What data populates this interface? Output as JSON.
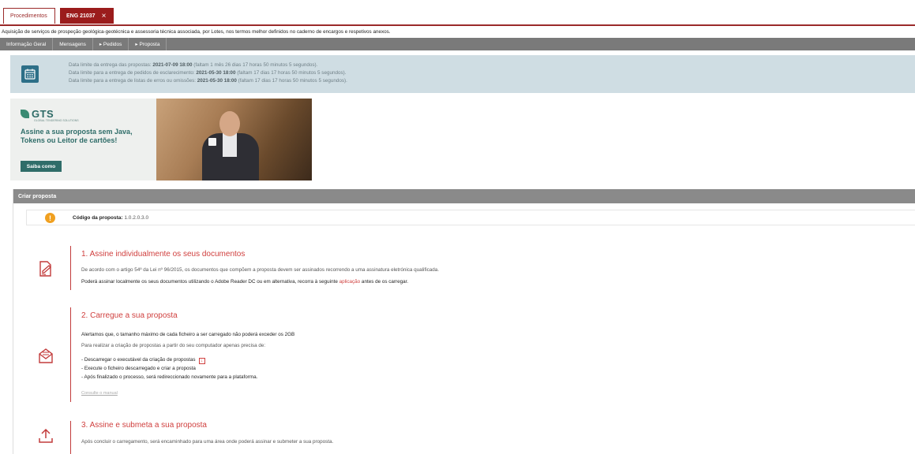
{
  "tabs": {
    "procedimentos": "Procedimentos",
    "current": "ENG 21037",
    "close": "×"
  },
  "subject": "Aquisição de serviços de prospeção geológica-geotécnica e assessoria técnica associada, por Lotes, nos termos melhor definidos no caderno de encargos e respetivos anexos.",
  "nav": {
    "items": [
      "Informação Geral",
      "Mensagens",
      "▸ Pedidos",
      "▸ Proposta"
    ]
  },
  "deadlines": {
    "icon": "calendar-icon",
    "line1_prefix": "Data limite da entrega das propostas: ",
    "line1_date": "2021-07-09 18:00",
    "line1_suffix": " (faltam 1 mês 26 dias 17 horas 50 minutos 5 segundos).",
    "line2_prefix": "Data limite para a entrega de pedidos de esclarecimento: ",
    "line2_date": "2021-05-30 18:00",
    "line2_suffix": " (faltam 17 dias 17 horas 50 minutos 5 segundos).",
    "line3_prefix": "Data limite para a entrega de listas de erros ou omissões: ",
    "line3_date": "2021-05-30 18:00",
    "line3_suffix": " (faltam 17 dias 17 horas 50 minutos 5 segundos)."
  },
  "banner": {
    "logo": "GTS",
    "logo_sub": "GLOBAL TENDERING SOLUTIONS",
    "headline": "Assine a sua proposta sem Java, Tokens ou Leitor de cartões!",
    "button": "Saiba como"
  },
  "panel": {
    "title": "Criar proposta",
    "code_label": "Código da proposta:",
    "code_value": " 1.0.2.0.3.0"
  },
  "steps": {
    "s1": {
      "icon": "sign-document-icon",
      "title": "1. Assine individualmente os seus documentos",
      "line1": "De acordo com o artigo 54º da Lei nº 96/2015, os documentos que compõem a proposta devem ser assinados recorrendo a uma assinatura eletrónica qualificada.",
      "line2_prefix": "Poderá assinar localmente os seus documentos utilizando o Adobe Reader DC ou em alternativa, recorra à seguinte ",
      "line2_link": "aplicação",
      "line2_suffix": " antes de os carregar."
    },
    "s2": {
      "icon": "upload-envelope-icon",
      "title": "2. Carregue a sua proposta",
      "line1": "Alertamos que, o tamanho máximo de cada ficheiro a ser carregado não poderá exceder os 2GB",
      "line2": "Para realizar a criação de propostas a partir do seu computador apenas precisa de:",
      "item1": "- Descarregar o executável da criação de propostas",
      "item2": "- Execute o ficheiro descarregado e criar a proposta",
      "item3": "- Após finalizado o processo, será redireccionado novamente para a plataforma.",
      "manual": "Consulte o manual"
    },
    "s3": {
      "icon": "upload-icon",
      "title": "3. Assine e submeta a sua proposta",
      "line1": "Após concluir o carregamento, será encaminhado para uma área onde poderá assinar e submeter a sua proposta."
    }
  },
  "colors": {
    "accent": "#9b1c1c",
    "step_red": "#d0403f",
    "deadline_bg": "#cfdde3",
    "brand_teal": "#2f6d69"
  }
}
